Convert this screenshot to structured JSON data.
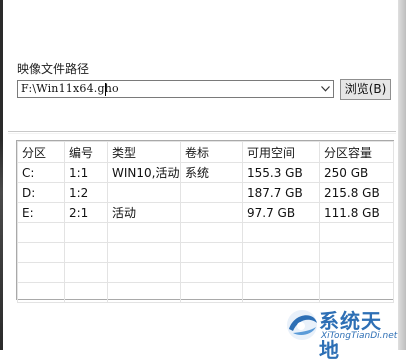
{
  "form": {
    "path_label": "映像文件路径",
    "path_value": "F:\\Win11x64.gho",
    "browse_label": "浏览(B)"
  },
  "table": {
    "headers": [
      "分区",
      "编号",
      "类型",
      "卷标",
      "可用空间",
      "分区容量"
    ],
    "rows": [
      [
        "C:",
        "1:1",
        "WIN10,活动",
        "系统",
        "155.3 GB",
        "250 GB"
      ],
      [
        "D:",
        "1:2",
        "",
        "",
        "187.7 GB",
        "215.8 GB"
      ],
      [
        "E:",
        "2:1",
        "活动",
        "",
        "97.7 GB",
        "111.8 GB"
      ],
      [
        "",
        "",
        "",
        "",
        "",
        ""
      ],
      [
        "",
        "",
        "",
        "",
        "",
        ""
      ],
      [
        "",
        "",
        "",
        "",
        "",
        ""
      ],
      [
        "",
        "",
        "",
        "",
        "",
        ""
      ]
    ]
  },
  "watermark": {
    "title": "系统天地",
    "subtitle": "XiTongTianDi.net"
  },
  "colors": {
    "watermark_blue": "#2d6fb5",
    "grid_line": "#e3e3e3"
  }
}
